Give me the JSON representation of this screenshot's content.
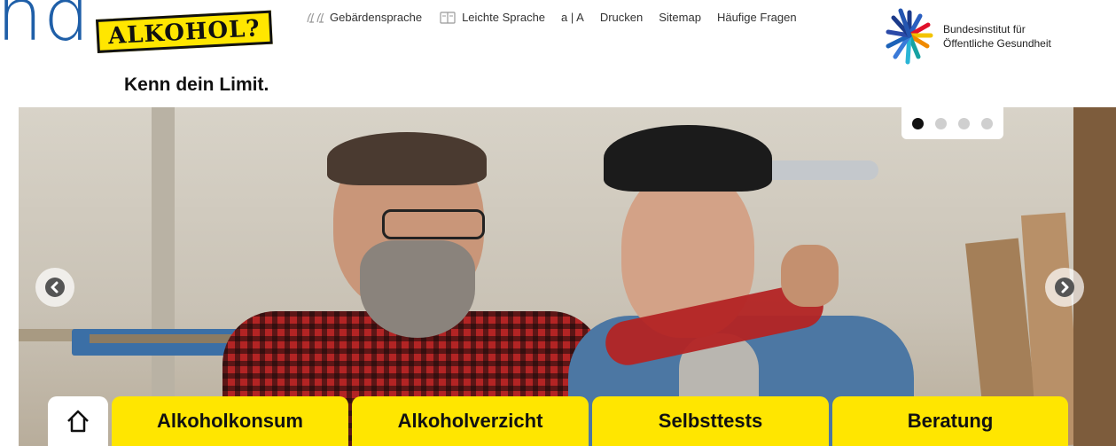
{
  "partial_logo_text": "nd",
  "logo": {
    "badge": "ALKOHOL?",
    "slogan": "Kenn dein Limit."
  },
  "service_nav": [
    {
      "label": "Gebärdensprache",
      "icon": "sign-language-icon"
    },
    {
      "label": "Leichte Sprache",
      "icon": "easy-language-icon"
    },
    {
      "label": "a | A"
    },
    {
      "label": "Drucken"
    },
    {
      "label": "Sitemap"
    },
    {
      "label": "Häufige Fragen"
    }
  ],
  "institute": {
    "line1": "Bundesinstitut für",
    "line2": "Öffentliche Gesundheit"
  },
  "carousel": {
    "slide_count": 4,
    "active_index": 0
  },
  "main_nav": {
    "home_icon": "home-icon",
    "tabs": [
      "Alkoholkonsum",
      "Alkoholverzicht",
      "Selbsttests",
      "Beratung"
    ]
  },
  "colors": {
    "brand_yellow": "#ffe600",
    "brand_blue": "#1f5fa8"
  }
}
